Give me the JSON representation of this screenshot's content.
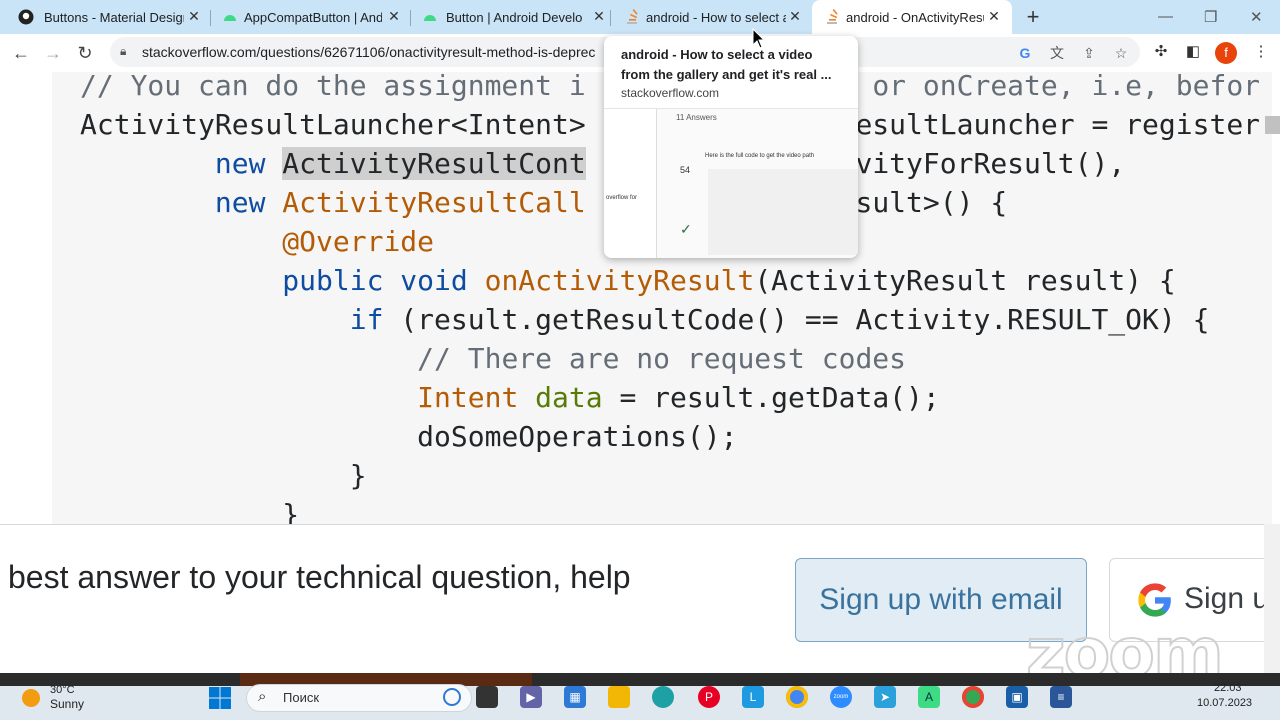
{
  "tabs": [
    {
      "title": "Buttons - Material Design",
      "icon": "github-icon"
    },
    {
      "title": "AppCompatButton  |  And",
      "icon": "android-icon"
    },
    {
      "title": "Button  |  Android Develo",
      "icon": "android-icon"
    },
    {
      "title": "android - How to select a",
      "icon": "stackoverflow-icon"
    },
    {
      "title": "android - OnActivityResult",
      "icon": "stackoverflow-icon",
      "active": true
    }
  ],
  "address_bar": {
    "url": "stackoverflow.com/questions/62671106/onactivityresult-method-is-deprec"
  },
  "profile_initial": "f",
  "code_lines": [
    {
      "parts": [
        {
          "t": "// You can do the assignment i",
          "c": "cm"
        },
        {
          "t": "                 ",
          "c": ""
        },
        {
          "t": "or onCreate, i.e, befor",
          "c": "cm"
        }
      ]
    },
    {
      "parts": [
        {
          "t": "ActivityResultLauncher<Intent>",
          "c": ""
        },
        {
          "t": "                ",
          "c": ""
        },
        {
          "t": "esultLauncher = register",
          "c": ""
        }
      ]
    },
    {
      "parts": [
        {
          "t": "        ",
          "c": ""
        },
        {
          "t": "new",
          "c": "kw"
        },
        {
          "t": " ",
          "c": ""
        },
        {
          "t": "ActivityResultCont",
          "c": "hl"
        },
        {
          "t": "               ",
          "c": ""
        },
        {
          "t": "ivityForResult(),",
          "c": ""
        }
      ]
    },
    {
      "parts": [
        {
          "t": "        ",
          "c": ""
        },
        {
          "t": "new",
          "c": "kw"
        },
        {
          "t": " ",
          "c": ""
        },
        {
          "t": "ActivityResultCall",
          "c": "ty"
        },
        {
          "t": "               ",
          "c": ""
        },
        {
          "t": "esult>() {",
          "c": ""
        }
      ]
    },
    {
      "parts": [
        {
          "t": "            ",
          "c": ""
        },
        {
          "t": "@Override",
          "c": "ty"
        }
      ]
    },
    {
      "parts": [
        {
          "t": "            ",
          "c": ""
        },
        {
          "t": "public void",
          "c": "kw"
        },
        {
          "t": " ",
          "c": ""
        },
        {
          "t": "onActivityResult",
          "c": "ty"
        },
        {
          "t": "(ActivityResult result) {",
          "c": ""
        }
      ]
    },
    {
      "parts": [
        {
          "t": "                ",
          "c": ""
        },
        {
          "t": "if",
          "c": "kw"
        },
        {
          "t": " (result.getResultCode() == Activity.RESULT_OK) {",
          "c": ""
        }
      ]
    },
    {
      "parts": [
        {
          "t": "                    ",
          "c": ""
        },
        {
          "t": "// There are no request codes",
          "c": "cm"
        }
      ]
    },
    {
      "parts": [
        {
          "t": "                    ",
          "c": ""
        },
        {
          "t": "Intent",
          "c": "ty"
        },
        {
          "t": " ",
          "c": ""
        },
        {
          "t": "data",
          "c": "vr"
        },
        {
          "t": " = result.getData();",
          "c": ""
        }
      ]
    },
    {
      "parts": [
        {
          "t": "                    ",
          "c": ""
        },
        {
          "t": "doSomeOperations();",
          "c": ""
        }
      ]
    },
    {
      "parts": [
        {
          "t": "                ",
          "c": ""
        },
        {
          "t": "}",
          "c": ""
        }
      ]
    },
    {
      "parts": [
        {
          "t": "            ",
          "c": ""
        },
        {
          "t": "}",
          "c": ""
        }
      ]
    }
  ],
  "hover_preview": {
    "title": "android - How to select a video from the gallery and get it's real ...",
    "domain": "stackoverflow.com",
    "thumb_answers": "11 Answers",
    "thumb_votes": "54",
    "thumb_text": "Here is the full code to get the video path",
    "thumb_sidebar": "overflow for"
  },
  "banner": {
    "text": "best answer to your technical question, help",
    "signup_email": "Sign up with email",
    "signup_google": "Sign u"
  },
  "watermark": "zoom",
  "taskbar": {
    "weather_temp": "30°C",
    "weather_desc": "Sunny",
    "search_placeholder": "Поиск",
    "time": "22:03",
    "date": "10.07.2023"
  },
  "colors": {
    "accent": "#1a73e8",
    "tabstrip": "#c9e4f6",
    "keyword": "#0e4ca1",
    "type": "#b45b06",
    "comment": "#656e77"
  }
}
